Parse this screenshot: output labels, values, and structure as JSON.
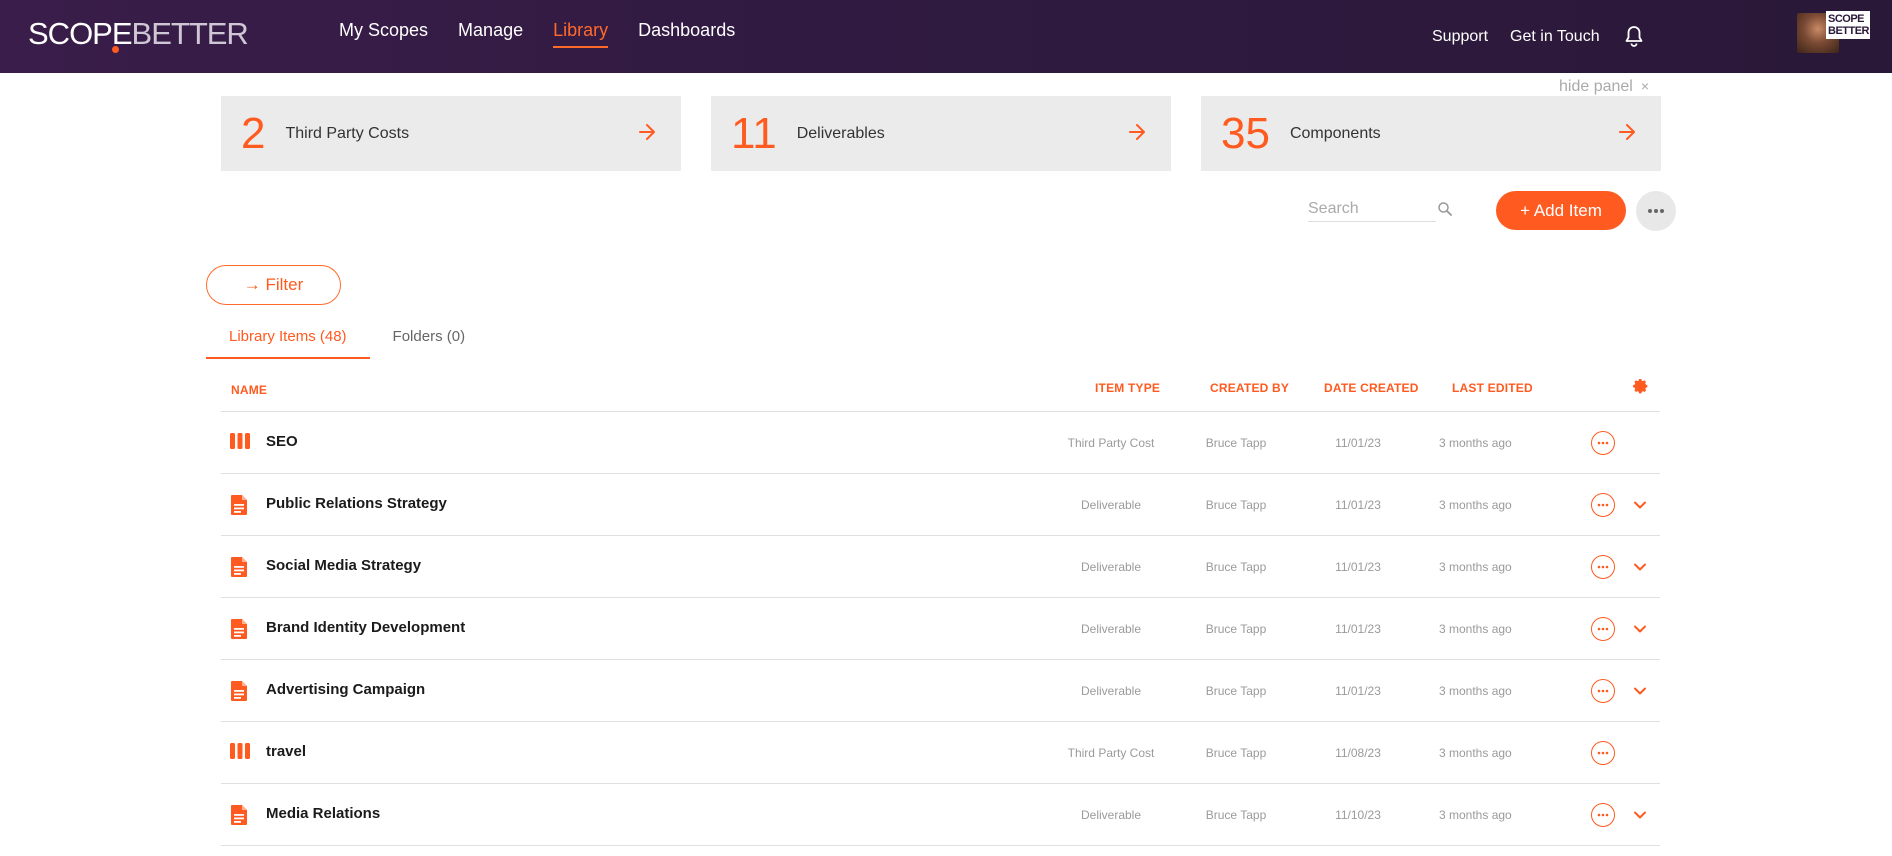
{
  "brand": {
    "logo_main": "SCOPE",
    "logo_accent": "BETTER",
    "mini_logo": "SCOPE BETTER"
  },
  "nav": {
    "items": [
      {
        "label": "My Scopes"
      },
      {
        "label": "Manage"
      },
      {
        "label": "Library"
      },
      {
        "label": "Dashboards"
      }
    ],
    "support": "Support",
    "contact": "Get in Touch"
  },
  "panel": {
    "hide_label": "hide panel",
    "close": "×"
  },
  "stats": [
    {
      "value": "2",
      "label": "Third Party Costs"
    },
    {
      "value": "11",
      "label": "Deliverables"
    },
    {
      "value": "35",
      "label": "Components"
    }
  ],
  "toolbar": {
    "search_placeholder": "Search",
    "add_label": "+ Add Item",
    "filter_label": "→ Filter"
  },
  "tabs": [
    {
      "label": "Library Items (48)"
    },
    {
      "label": "Folders (0)"
    }
  ],
  "table": {
    "headers": {
      "name": "NAME",
      "type": "ITEM TYPE",
      "by": "CREATED BY",
      "date": "DATE CREATED",
      "edited": "LAST EDITED"
    },
    "rows": [
      {
        "name": "SEO",
        "type": "Third Party Cost",
        "by": "Bruce Tapp",
        "date": "11/01/23",
        "edited": "3 months ago",
        "icon": "third-party-cost-icon"
      },
      {
        "name": "Public Relations Strategy",
        "type": "Deliverable",
        "by": "Bruce Tapp",
        "date": "11/01/23",
        "edited": "3 months ago",
        "icon": "document-icon"
      },
      {
        "name": "Social Media Strategy",
        "type": "Deliverable",
        "by": "Bruce Tapp",
        "date": "11/01/23",
        "edited": "3 months ago",
        "icon": "document-icon"
      },
      {
        "name": "Brand Identity Development",
        "type": "Deliverable",
        "by": "Bruce Tapp",
        "date": "11/01/23",
        "edited": "3 months ago",
        "icon": "document-icon"
      },
      {
        "name": "Advertising Campaign",
        "type": "Deliverable",
        "by": "Bruce Tapp",
        "date": "11/01/23",
        "edited": "3 months ago",
        "icon": "document-icon"
      },
      {
        "name": "travel",
        "type": "Third Party Cost",
        "by": "Bruce Tapp",
        "date": "11/08/23",
        "edited": "3 months ago",
        "icon": "third-party-cost-icon"
      },
      {
        "name": "Media Relations",
        "type": "Deliverable",
        "by": "Bruce Tapp",
        "date": "11/10/23",
        "edited": "3 months ago",
        "icon": "document-icon"
      }
    ]
  },
  "colors": {
    "accent": "#ff5a1f",
    "topbar": "#2f1a40",
    "panel": "#ebebeb"
  }
}
